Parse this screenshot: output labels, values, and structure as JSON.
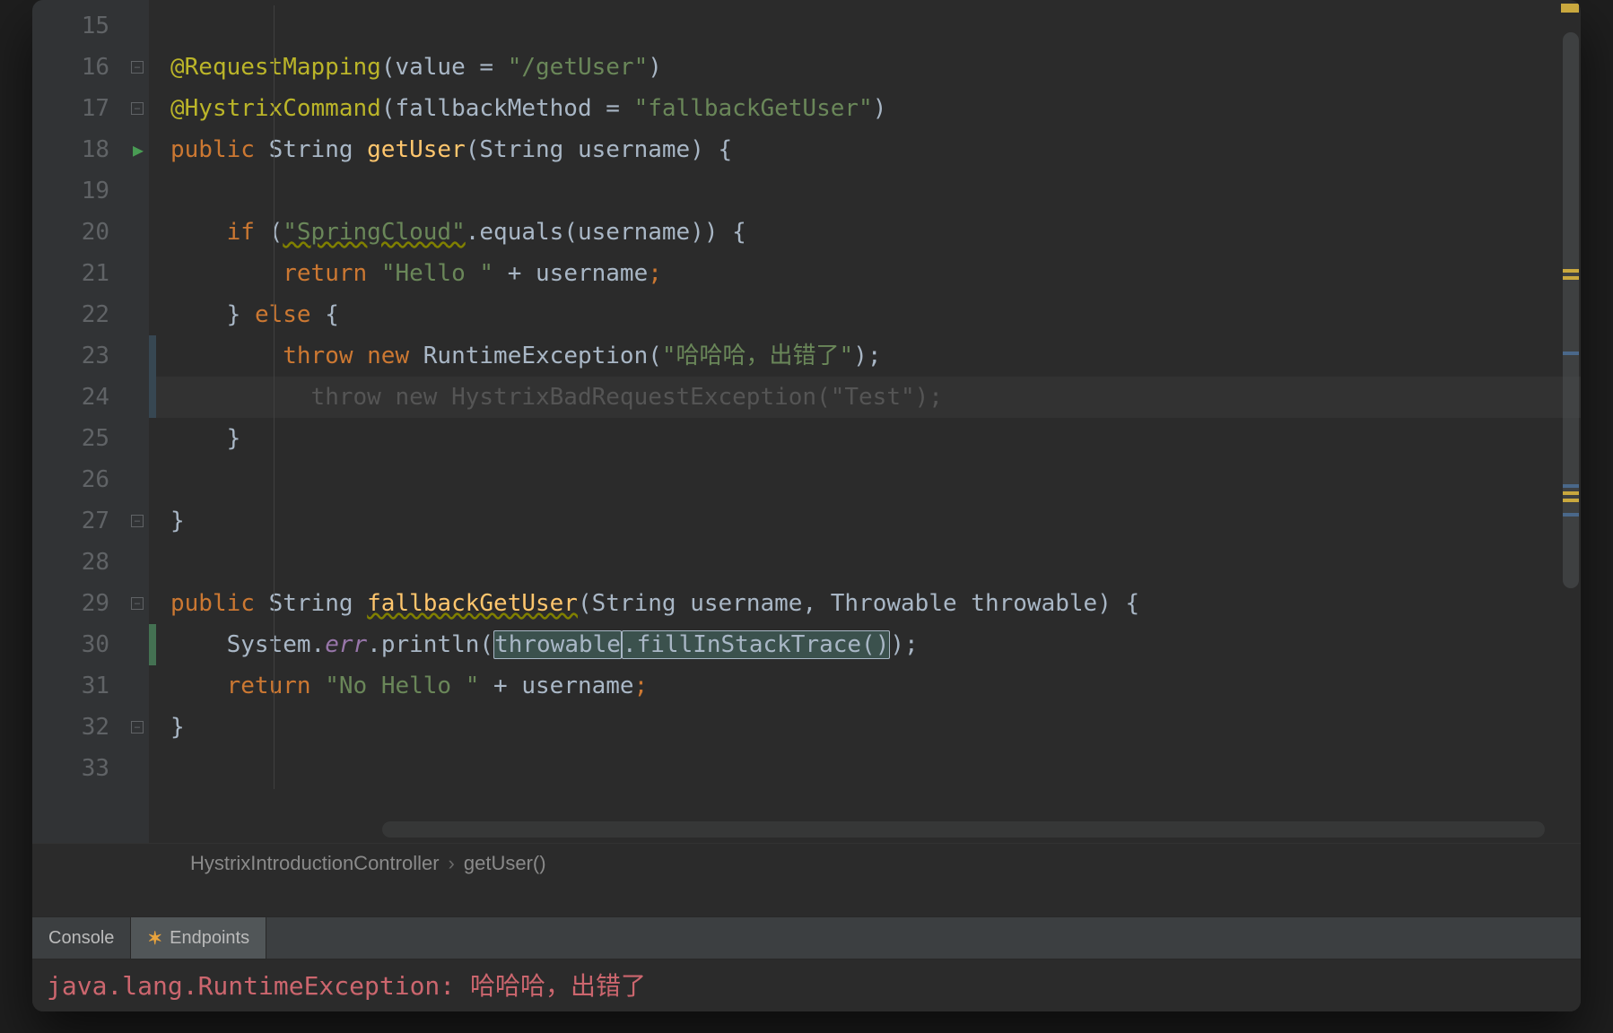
{
  "gutter": {
    "lines": [
      "15",
      "16",
      "17",
      "18",
      "19",
      "20",
      "21",
      "22",
      "23",
      "24",
      "25",
      "26",
      "27",
      "28",
      "29",
      "30",
      "31",
      "32",
      "33"
    ],
    "run_line": "18"
  },
  "code": {
    "l16": {
      "ann": "@RequestMapping",
      "p1": "(",
      "id1": "value ",
      "eq": "=",
      "sp": " ",
      "str": "\"/getUser\"",
      "p2": ")"
    },
    "l17": {
      "ann": "@HystrixCommand",
      "p1": "(",
      "id1": "fallbackMethod ",
      "eq": "=",
      "sp": " ",
      "str": "\"fallbackGetUser\"",
      "p2": ")"
    },
    "l18": {
      "kw1": "public ",
      "type": "String ",
      "m": "getUser",
      "p1": "(",
      "type2": "String ",
      "arg": "username",
      "p2": ") {"
    },
    "l20": {
      "kw": "if ",
      "p1": "(",
      "str": "\"SpringCloud\"",
      "dot": ".equals(",
      "arg": "username",
      "p2": ")) {"
    },
    "l21": {
      "kw": "return ",
      "str": "\"Hello \" ",
      "plus": "+ ",
      "arg": "username",
      "semi": ";"
    },
    "l22": {
      "b1": "} ",
      "kw": "else ",
      "b2": "{"
    },
    "l23": {
      "kw1": "throw ",
      "kw2": "new ",
      "type": "RuntimeException",
      "p1": "(",
      "str": "\"哈哈哈，出错了\"",
      "p2": ");"
    },
    "l24": {
      "text": "throw new HystrixBadRequestException(\"Test\");"
    },
    "l25": {
      "b": "}"
    },
    "l27": {
      "b": "}"
    },
    "l29": {
      "kw1": "public ",
      "type": "String ",
      "m": "fallbackGetUser",
      "p1": "(",
      "type2": "String ",
      "arg1": "username",
      "c": ", ",
      "type3": "Throwable ",
      "arg2": "throwable",
      "p2": ") {"
    },
    "l30": {
      "cls": "System.",
      "field": "err",
      "m1": ".println",
      "p1": "(",
      "arg": "throwable",
      ".": ".fillInStackTrace",
      "paren": "(",
      ")": ")",
      "p2": ");"
    },
    "l31": {
      "kw": "return ",
      "str": "\"No Hello \" ",
      "plus": "+ ",
      "arg": "username",
      "semi": ";"
    },
    "l32": {
      "b": "}"
    }
  },
  "breadcrumb": {
    "item1": "HystrixIntroductionController",
    "item2": "getUser()"
  },
  "tabs": {
    "t1": "Console",
    "t2": "Endpoints"
  },
  "console": {
    "line1": "java.lang.RuntimeException: 哈哈哈，出错了"
  }
}
